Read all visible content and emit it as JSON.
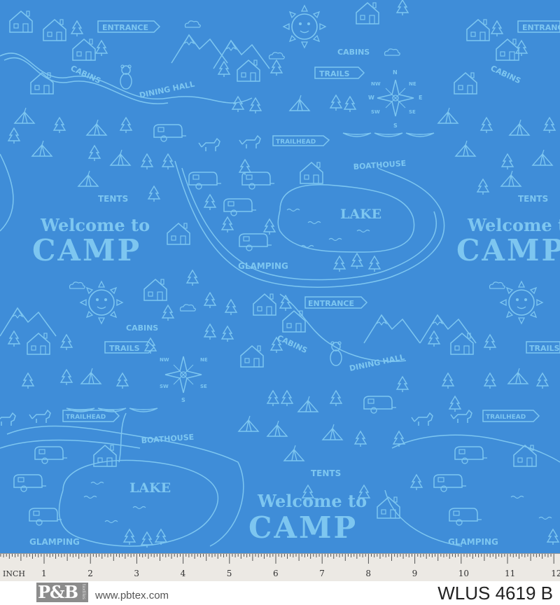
{
  "fabric": {
    "background": "#3b8ad6",
    "line_color": "#7dc6f0",
    "labels": {
      "entrance": "ENTRANCE",
      "cabins": "CABINS",
      "dining_hall": "DINING HALL",
      "trails": "TRAILS",
      "trailhead": "TRAILHEAD",
      "boathouse": "BOATHOUSE",
      "tents": "TENTS",
      "lake": "LAKE",
      "glamping": "GLAMPING",
      "welcome": "Welcome to",
      "camp": "CAMP",
      "compass": {
        "n": "N",
        "s": "S",
        "e": "E",
        "w": "W",
        "ne": "NE",
        "nw": "NW",
        "se": "SE",
        "sw": "SW"
      }
    }
  },
  "ruler": {
    "unit_label": "INCH",
    "numbers": [
      "1",
      "2",
      "3",
      "4",
      "5",
      "6",
      "7",
      "8",
      "9",
      "10",
      "11",
      "12"
    ]
  },
  "footer": {
    "logo": "P&B",
    "logo_sub": "textiles",
    "website": "www.pbtex.com",
    "sku": "WLUS 4619 B"
  }
}
